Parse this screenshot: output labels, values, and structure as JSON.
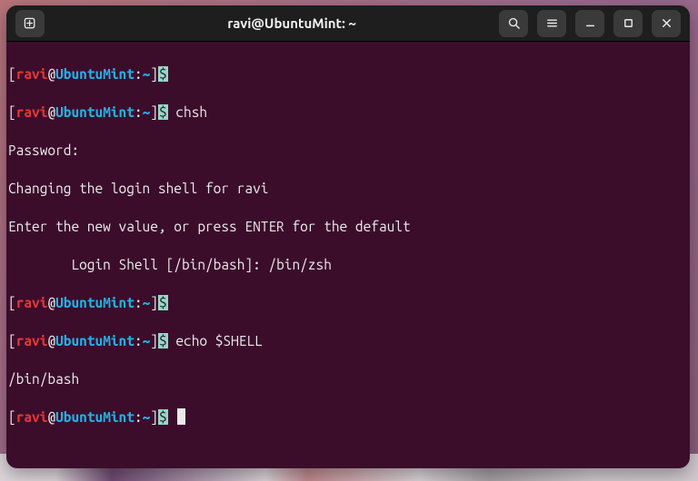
{
  "title": "ravi@UbuntuMint: ~",
  "prompt": {
    "open": "[",
    "user": "ravi",
    "at": "@",
    "host": "UbuntuMint",
    "colon": ":",
    "path": "~",
    "close": "]",
    "dollar": "$"
  },
  "lines": {
    "l1_cmd": "",
    "l2_cmd": " chsh",
    "l3": "Password:",
    "l4": "Changing the login shell for ravi",
    "l5": "Enter the new value, or press ENTER for the default",
    "l6": "        Login Shell [/bin/bash]: /bin/zsh",
    "l7_cmd": "",
    "l8_cmd": " echo $SHELL",
    "l9": "/bin/bash",
    "l10_cmd": " "
  },
  "icons": {
    "newtab": "new-tab",
    "search": "search",
    "menu": "menu",
    "minimize": "minimize",
    "maximize": "maximize",
    "close": "close"
  }
}
